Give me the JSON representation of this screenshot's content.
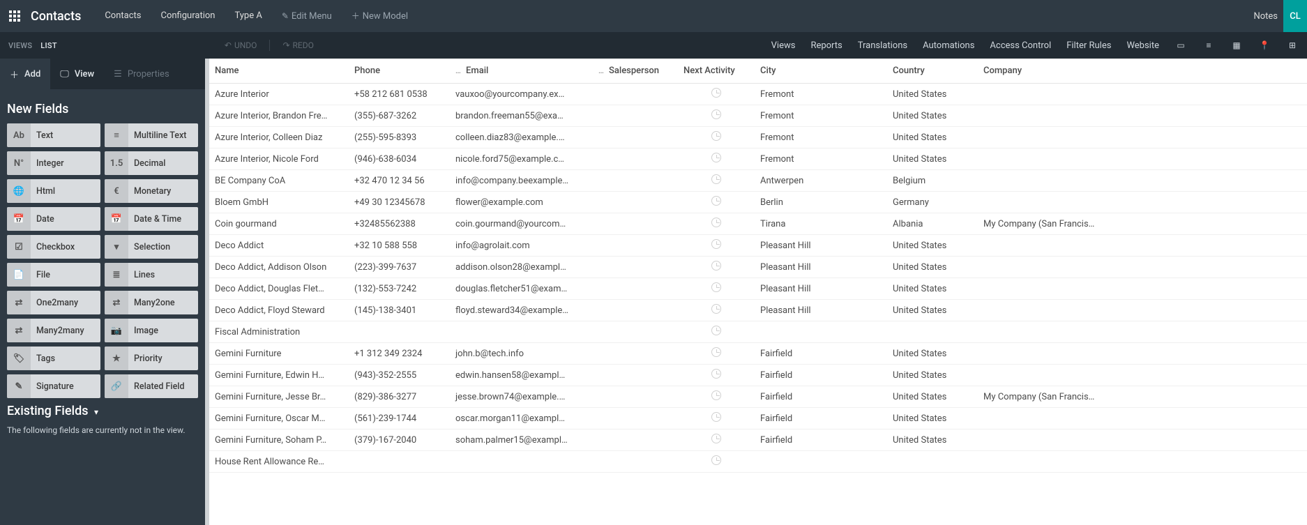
{
  "topbar": {
    "app_title": "Contacts",
    "nav": [
      "Contacts",
      "Configuration",
      "Type A"
    ],
    "edit_menu": "Edit Menu",
    "new_model": "New Model",
    "notes": "Notes",
    "avatar": "CL"
  },
  "secondbar": {
    "views_label": "VIEWS",
    "list_label": "LIST",
    "undo": "UNDO",
    "redo": "REDO",
    "links": [
      "Views",
      "Reports",
      "Translations",
      "Automations",
      "Access Control",
      "Filter Rules",
      "Website"
    ]
  },
  "sidebar": {
    "tabs": {
      "add": "Add",
      "view": "View",
      "props": "Properties"
    },
    "new_fields_title": "New Fields",
    "fields": [
      {
        "icon": "Ab",
        "label": "Text"
      },
      {
        "icon": "≡",
        "label": "Multiline Text"
      },
      {
        "icon": "N°",
        "label": "Integer"
      },
      {
        "icon": "1.5",
        "label": "Decimal"
      },
      {
        "icon": "🌐",
        "label": "Html"
      },
      {
        "icon": "€",
        "label": "Monetary"
      },
      {
        "icon": "📅",
        "label": "Date"
      },
      {
        "icon": "📅",
        "label": "Date & Time"
      },
      {
        "icon": "☑",
        "label": "Checkbox"
      },
      {
        "icon": "▾",
        "label": "Selection"
      },
      {
        "icon": "📄",
        "label": "File"
      },
      {
        "icon": "≣",
        "label": "Lines"
      },
      {
        "icon": "⇄",
        "label": "One2many"
      },
      {
        "icon": "⇄",
        "label": "Many2one"
      },
      {
        "icon": "⇄",
        "label": "Many2many"
      },
      {
        "icon": "📷",
        "label": "Image"
      },
      {
        "icon": "🏷",
        "label": "Tags"
      },
      {
        "icon": "★",
        "label": "Priority"
      },
      {
        "icon": "✎",
        "label": "Signature"
      },
      {
        "icon": "🔗",
        "label": "Related Field"
      }
    ],
    "existing_fields_title": "Existing Fields",
    "existing_note": "The following fields are currently not in the view."
  },
  "table": {
    "headers": {
      "name": "Name",
      "phone": "Phone",
      "email": "Email",
      "salesperson": "Salesperson",
      "next_activity": "Next Activity",
      "city": "City",
      "country": "Country",
      "company": "Company"
    },
    "rows": [
      {
        "name": "Azure Interior",
        "phone": "+58 212 681 0538",
        "email": "vauxoo@yourcompany.ex…",
        "salesperson": "",
        "city": "Fremont",
        "country": "United States",
        "company": ""
      },
      {
        "name": "Azure Interior, Brandon Fre…",
        "phone": "(355)-687-3262",
        "email": "brandon.freeman55@exa…",
        "salesperson": "",
        "city": "Fremont",
        "country": "United States",
        "company": ""
      },
      {
        "name": "Azure Interior, Colleen Diaz",
        "phone": "(255)-595-8393",
        "email": "colleen.diaz83@example.…",
        "salesperson": "",
        "city": "Fremont",
        "country": "United States",
        "company": ""
      },
      {
        "name": "Azure Interior, Nicole Ford",
        "phone": "(946)-638-6034",
        "email": "nicole.ford75@example.c…",
        "salesperson": "",
        "city": "Fremont",
        "country": "United States",
        "company": ""
      },
      {
        "name": "BE Company CoA",
        "phone": "+32 470 12 34 56",
        "email": "info@company.beexample…",
        "salesperson": "",
        "city": "Antwerpen",
        "country": "Belgium",
        "company": ""
      },
      {
        "name": "Bloem GmbH",
        "phone": "+49 30 12345678",
        "email": "flower@example.com",
        "salesperson": "",
        "city": "Berlin",
        "country": "Germany",
        "company": ""
      },
      {
        "name": "Coin gourmand",
        "phone": "+32485562388",
        "email": "coin.gourmand@yourcom…",
        "salesperson": "",
        "city": "Tirana",
        "country": "Albania",
        "company": "My Company (San Francis…"
      },
      {
        "name": "Deco Addict",
        "phone": "+32 10 588 558",
        "email": "info@agrolait.com",
        "salesperson": "",
        "city": "Pleasant Hill",
        "country": "United States",
        "company": ""
      },
      {
        "name": "Deco Addict, Addison Olson",
        "phone": "(223)-399-7637",
        "email": "addison.olson28@exampl…",
        "salesperson": "",
        "city": "Pleasant Hill",
        "country": "United States",
        "company": ""
      },
      {
        "name": "Deco Addict, Douglas Flet…",
        "phone": "(132)-553-7242",
        "email": "douglas.fletcher51@exam…",
        "salesperson": "",
        "city": "Pleasant Hill",
        "country": "United States",
        "company": ""
      },
      {
        "name": "Deco Addict, Floyd Steward",
        "phone": "(145)-138-3401",
        "email": "floyd.steward34@example…",
        "salesperson": "",
        "city": "Pleasant Hill",
        "country": "United States",
        "company": ""
      },
      {
        "name": "Fiscal Administration",
        "phone": "",
        "email": "",
        "salesperson": "",
        "city": "",
        "country": "",
        "company": ""
      },
      {
        "name": "Gemini Furniture",
        "phone": "+1 312 349 2324",
        "email": "john.b@tech.info",
        "salesperson": "",
        "city": "Fairfield",
        "country": "United States",
        "company": ""
      },
      {
        "name": "Gemini Furniture, Edwin H…",
        "phone": "(943)-352-2555",
        "email": "edwin.hansen58@exampl…",
        "salesperson": "",
        "city": "Fairfield",
        "country": "United States",
        "company": ""
      },
      {
        "name": "Gemini Furniture, Jesse Br…",
        "phone": "(829)-386-3277",
        "email": "jesse.brown74@example.…",
        "salesperson": "",
        "city": "Fairfield",
        "country": "United States",
        "company": "My Company (San Francis…"
      },
      {
        "name": "Gemini Furniture, Oscar M…",
        "phone": "(561)-239-1744",
        "email": "oscar.morgan11@exampl…",
        "salesperson": "",
        "city": "Fairfield",
        "country": "United States",
        "company": ""
      },
      {
        "name": "Gemini Furniture, Soham P…",
        "phone": "(379)-167-2040",
        "email": "soham.palmer15@exampl…",
        "salesperson": "",
        "city": "Fairfield",
        "country": "United States",
        "company": ""
      },
      {
        "name": "House Rent Allowance Re…",
        "phone": "",
        "email": "",
        "salesperson": "",
        "city": "",
        "country": "",
        "company": ""
      }
    ]
  }
}
